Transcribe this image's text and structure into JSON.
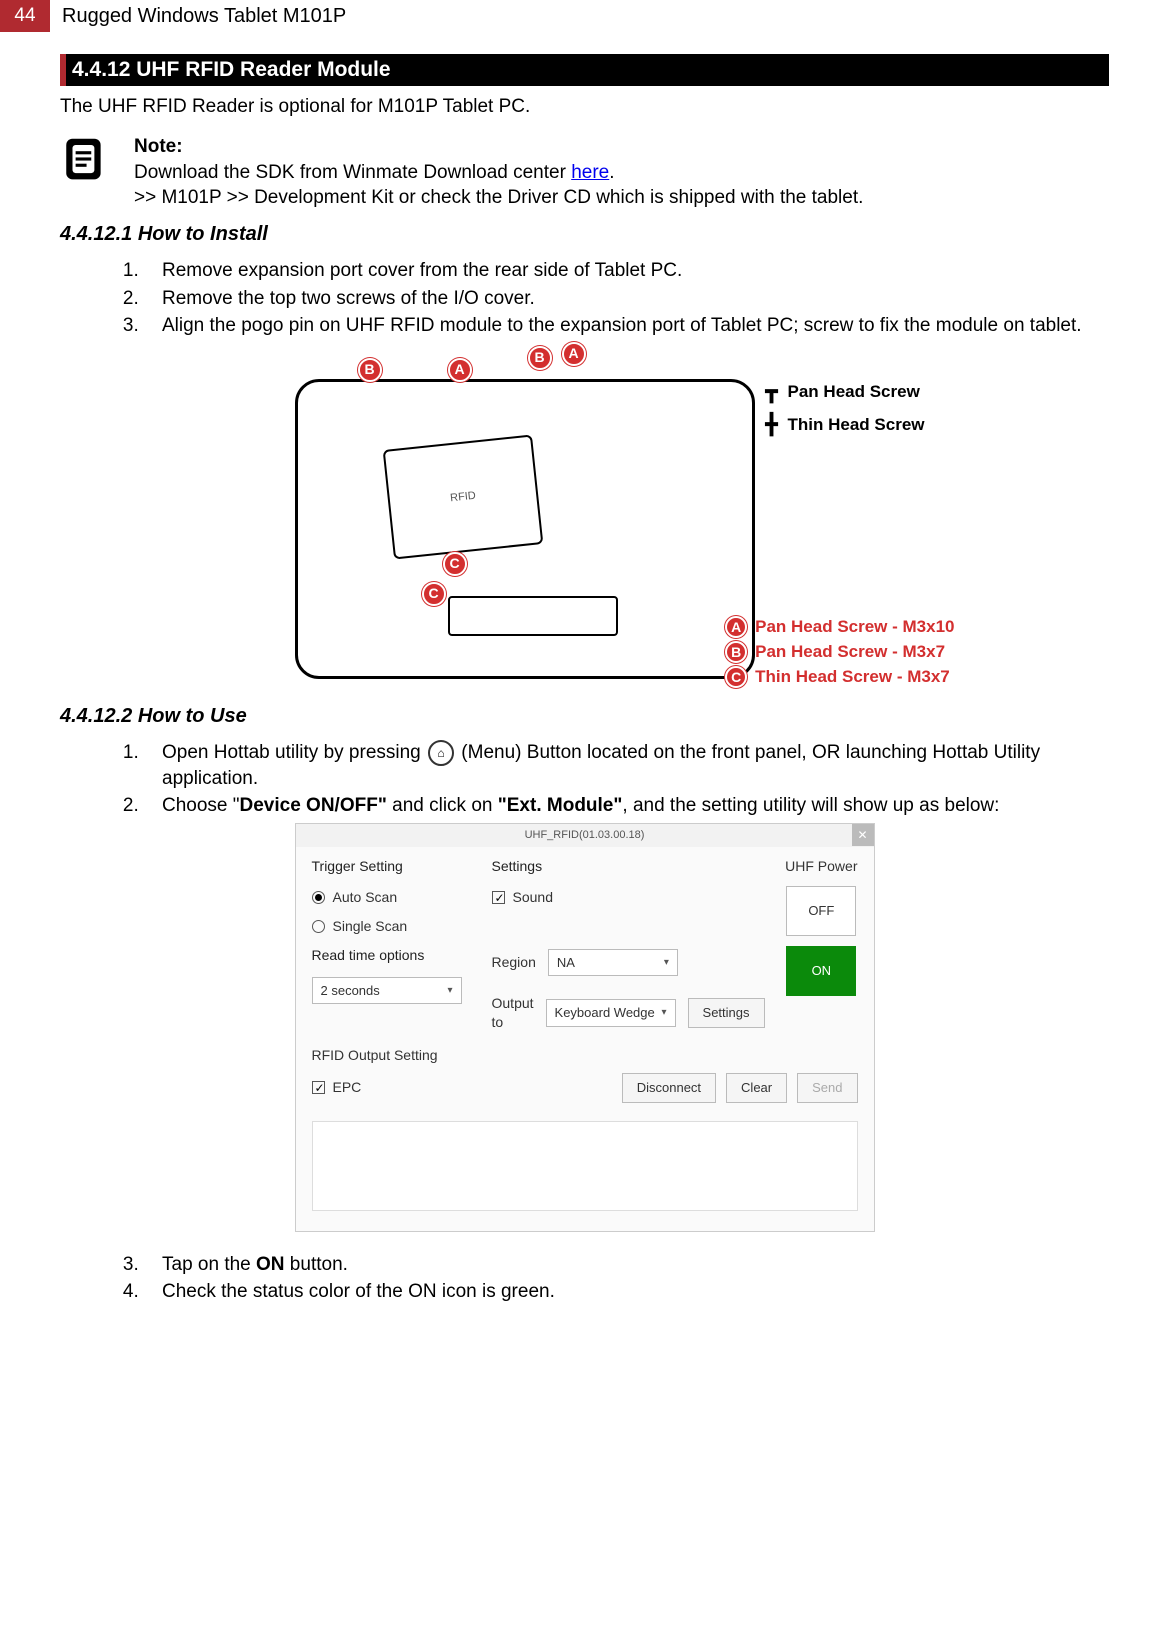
{
  "page_number": "44",
  "doc_title": "Rugged Windows Tablet M101P",
  "section_heading": "4.4.12 UHF RFID Reader Module",
  "intro": "The UHF RFID Reader is optional for M101P Tablet PC.",
  "note": {
    "title": "Note:",
    "line1_a": "Download the SDK from Winmate Download center ",
    "link": "here",
    "line1_b": ".",
    "line2": ">> M101P >> Development Kit or check the Driver CD which is shipped with the tablet."
  },
  "install": {
    "heading": "4.4.12.1 How to Install",
    "steps": [
      "Remove expansion port cover from the rear side of Tablet PC.",
      "Remove the top two screws of the I/O cover.",
      "Align the pogo pin on UHF RFID module to the expansion port of Tablet PC; screw to fix the module on tablet."
    ],
    "rfid_label": "RFID",
    "screw_legend_top": [
      "Pan Head Screw",
      "Thin Head Screw"
    ],
    "screw_legend_bottom": [
      {
        "m": "A",
        "t": "Pan Head Screw - M3x10"
      },
      {
        "m": "B",
        "t": "Pan Head Screw - M3x7"
      },
      {
        "m": "C",
        "t": "Thin Head Screw - M3x7"
      }
    ]
  },
  "use": {
    "heading": "4.4.12.2 How to Use",
    "step1_a": "Open Hottab utility by pressing ",
    "step1_b": " (Menu) Button located on the front panel, OR launching Hottab Utility application.",
    "step2_a": "Choose \"",
    "step2_bold1": "Device ON/OFF\"",
    "step2_mid": " and click on ",
    "step2_bold2": "\"Ext. Module\"",
    "step2_b": ", and the setting utility will show up as below:",
    "step3_a": "Tap on the ",
    "step3_bold": "ON",
    "step3_b": " button.",
    "step4": "Check the status color of the ON icon is green."
  },
  "app": {
    "title": "UHF_RFID(01.03.00.18)",
    "trigger_label": "Trigger Setting",
    "auto_scan": "Auto Scan",
    "single_scan": "Single Scan",
    "read_time_label": "Read time options",
    "read_time_value": "2 seconds",
    "settings_label": "Settings",
    "sound": "Sound",
    "region_label": "Region",
    "region_value": "NA",
    "output_to_label": "Output to",
    "output_to_value": "Keyboard Wedge",
    "settings_btn": "Settings",
    "uhf_power_label": "UHF Power",
    "off": "OFF",
    "on": "ON",
    "rfid_output_label": "RFID Output Setting",
    "epc": "EPC",
    "disconnect": "Disconnect",
    "clear": "Clear",
    "send": "Send"
  }
}
